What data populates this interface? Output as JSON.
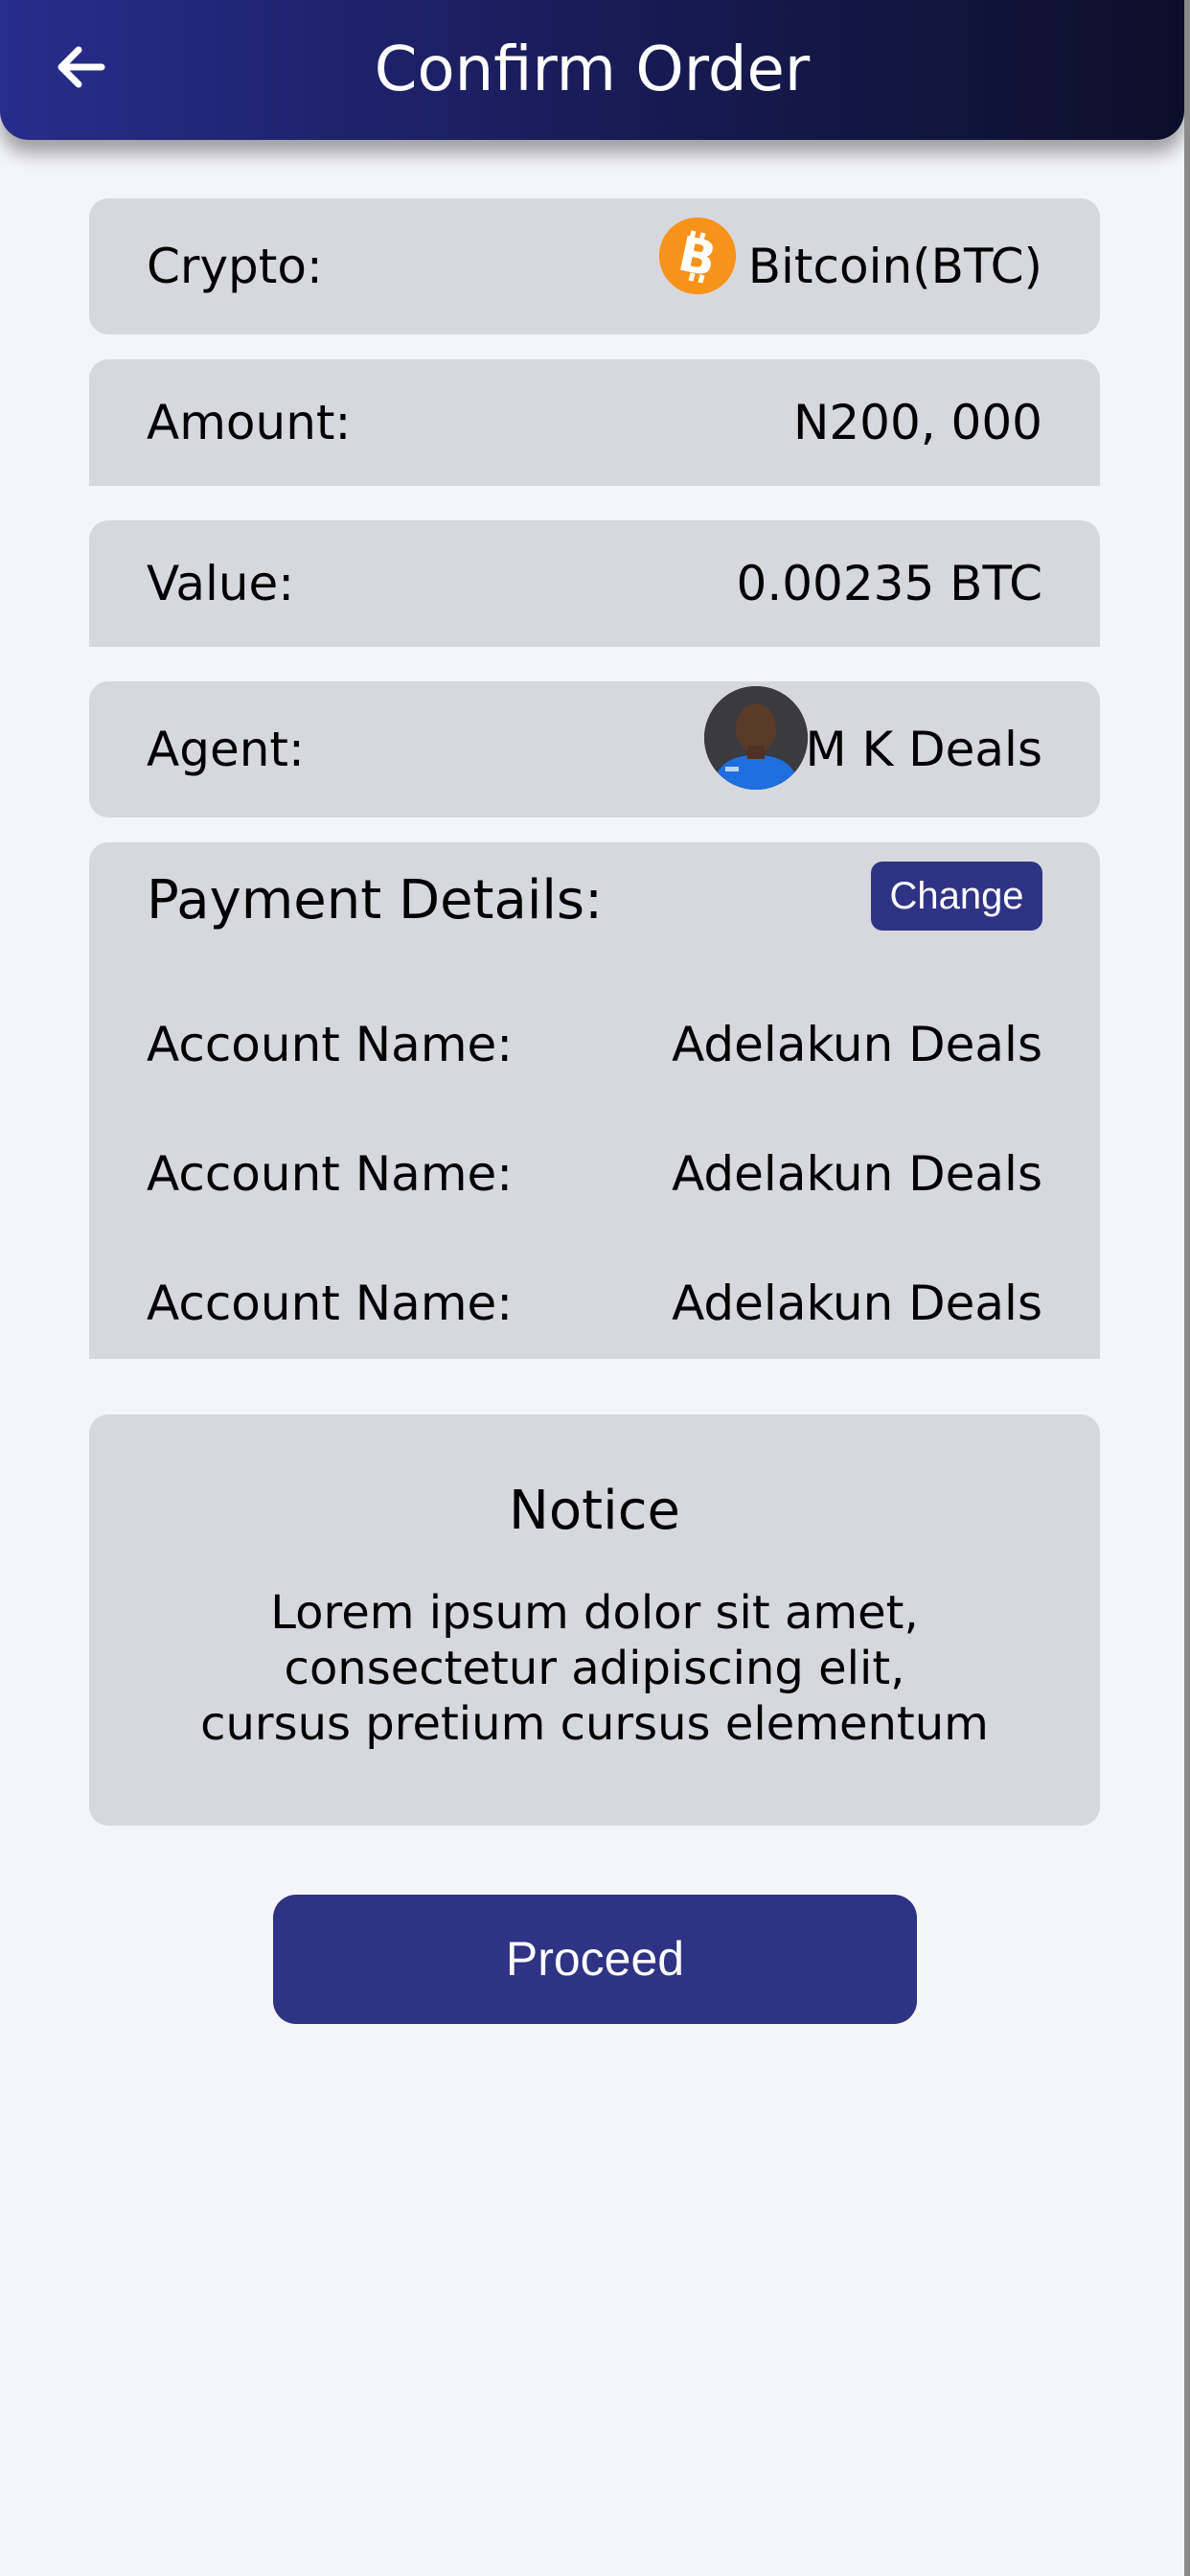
{
  "header": {
    "title": "Confirm Order",
    "back_icon": "arrow-left-icon"
  },
  "order": {
    "crypto_label": "Crypto:",
    "crypto_value": "Bitcoin(BTC)",
    "crypto_icon": "bitcoin-icon",
    "amount_label": "Amount:",
    "amount_value": "N200, 000",
    "value_label": "Value:",
    "value_value": "0.00235 BTC",
    "agent_label": "Agent:",
    "agent_value": "M K Deals"
  },
  "payment": {
    "title": "Payment Details:",
    "change_label": "Change",
    "rows": [
      {
        "label": "Account Name:",
        "value": "Adelakun Deals"
      },
      {
        "label": "Account Name:",
        "value": "Adelakun Deals"
      },
      {
        "label": "Account Name:",
        "value": "Adelakun Deals"
      }
    ]
  },
  "notice": {
    "title": "Notice",
    "lines": [
      "Lorem ipsum dolor sit amet,",
      "consectetur adipiscing elit,",
      "cursus pretium cursus elementum"
    ]
  },
  "actions": {
    "proceed_label": "Proceed"
  },
  "colors": {
    "header_start": "#272d8b",
    "header_end": "#0c0f2a",
    "accent": "#2f3384",
    "card": "#d6d8de",
    "background": "#f4f5f9",
    "bitcoin": "#f7931a"
  }
}
